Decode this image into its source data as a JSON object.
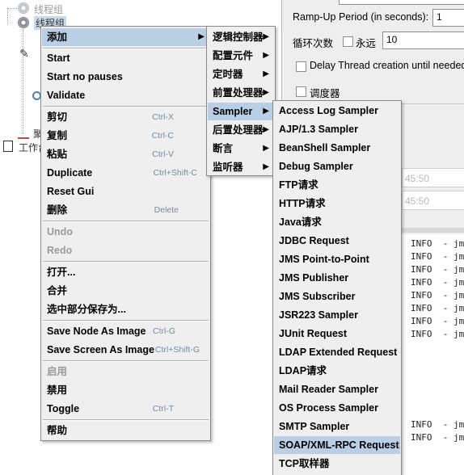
{
  "tree": {
    "thread_group_1": "线程组",
    "thread_group_2": "线程组",
    "workbench_prefix": "工作台",
    "partial_label": "聚"
  },
  "right_panel": {
    "ramp_up_label": "Ramp-Up Period (in seconds):",
    "ramp_up_value": "1",
    "loop_label": "循环次数",
    "forever_label": "永远",
    "loop_value": "10",
    "delay_label": "Delay Thread creation until needed",
    "scheduler_label": "调度器",
    "start_time": "45:50",
    "end_time": "45:50",
    "log_lines": [
      "INFO  - jm",
      "INFO  - jm",
      "INFO  - jm",
      "INFO  - jm",
      "INFO  - jm",
      "INFO  - jm",
      "INFO  - jm",
      "INFO  - jm",
      "INFO  - jm",
      "INFO  - jm"
    ]
  },
  "context_menu": {
    "add": "添加",
    "start": "Start",
    "start_no_pauses": "Start no pauses",
    "validate": "Validate",
    "cut": "剪切",
    "cut_sc": "Ctrl-X",
    "copy": "复制",
    "copy_sc": "Ctrl-C",
    "paste": "粘贴",
    "paste_sc": "Ctrl-V",
    "duplicate": "Duplicate",
    "duplicate_sc": "Ctrl+Shift-C",
    "reset_gui": "Reset Gui",
    "delete": "删除",
    "delete_sc": "Delete",
    "undo": "Undo",
    "redo": "Redo",
    "open": "打开...",
    "merge": "合并",
    "save_selection": "选中部分保存为...",
    "save_node_image": "Save Node As Image",
    "save_node_image_sc": "Ctrl-G",
    "save_screen_image": "Save Screen As Image",
    "save_screen_image_sc": "Ctrl+Shift-G",
    "enable": "启用",
    "disable": "禁用",
    "toggle": "Toggle",
    "toggle_sc": "Ctrl-T",
    "help": "帮助"
  },
  "add_submenu": {
    "logic_controller": "逻辑控制器",
    "config_element": "配置元件",
    "timer": "定时器",
    "pre_processor": "前置处理器",
    "sampler": "Sampler",
    "post_processor": "后置处理器",
    "assertion": "断言",
    "listener": "监听器"
  },
  "sampler_submenu": [
    "Access Log Sampler",
    "AJP/1.3 Sampler",
    "BeanShell Sampler",
    "Debug Sampler",
    "FTP请求",
    "HTTP请求",
    "Java请求",
    "JDBC Request",
    "JMS Point-to-Point",
    "JMS Publisher",
    "JMS Subscriber",
    "JSR223 Sampler",
    "JUnit Request",
    "LDAP Extended Request",
    "LDAP请求",
    "Mail Reader Sampler",
    "OS Process Sampler",
    "SMTP Sampler",
    "SOAP/XML-RPC Request",
    "TCP取样器"
  ],
  "icons": {
    "submenu_arrow": "▶"
  },
  "colors": {
    "menu_bg": "#efefef",
    "selected_bg": "#b8cfe5",
    "shortcut": "#7a8aa0",
    "disabled": "#9a9a9a"
  }
}
